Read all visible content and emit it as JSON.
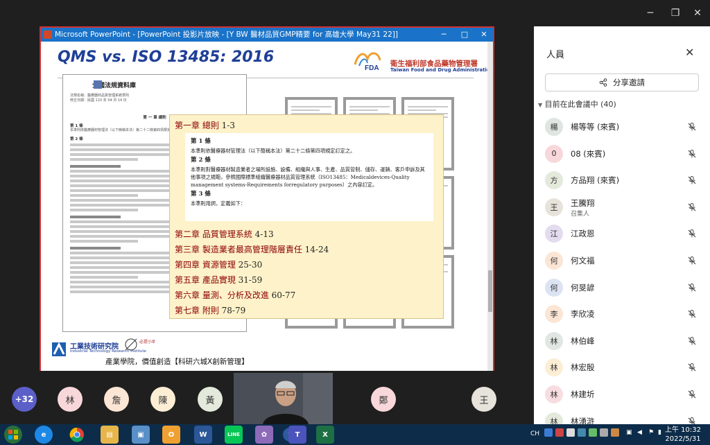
{
  "window": {
    "minimize_icon": "minimize-icon",
    "restore_icon": "restore-icon",
    "close_icon": "close-icon"
  },
  "ppt": {
    "title": "Microsoft PowerPoint - [PowerPoint 投影片放映 - [Y BW 醫材品質GMP精要 for 高雄大學 May31 22]]",
    "slide": {
      "title": "QMS vs. ISO 13485: 2016",
      "fda_name": "衛生福利部食品藥物管理署",
      "fda_en": "Taiwan Food and Drug Administration",
      "fda_logo": "FDA",
      "doc_header": "全國法規資料庫",
      "doc_lines": [
        "法規名稱：醫療器材品質管理系統準則",
        "修正日期：民國 110 年 04 月 14 日",
        "第 一 章 總則",
        "第 1 條",
        "本準則依醫療器材管理法（以下簡稱本法）第二十二條第四項規定訂定之。",
        "第 2 條"
      ],
      "popup": {
        "chapter1": "第一章 總則",
        "chapter1_range": "1-3",
        "art1_title": "第 1 條",
        "art1_text": "本準則依醫療器材管理法（以下簡稱本法）第二十二條第四項規定訂定之。",
        "art2_title": "第 2 條",
        "art2_text": "本準則對醫療器材製造業者之場所設施、設備、組織與人事、生產、品質管制、儲存、運銷、客戶申訴及其他事項之規範，參照國際標準組織醫療器材品質管理系統（ISO13485：Medicaldevices-Quality management systems-Requirements forregulatory purposes）之內容訂定。",
        "art3_title": "第 3 條",
        "art3_text": "本準則用詞，定義如下：",
        "chapters": [
          {
            "name": "第二章 品質管理系統",
            "range": "4-13"
          },
          {
            "name": "第三章 製造業者最高管理階層責任",
            "range": "14-24"
          },
          {
            "name": "第四章 資源管理",
            "range": "25-30"
          },
          {
            "name": "第五章 產品實現",
            "range": "31-59"
          },
          {
            "name": "第六章 量測、分析及改進",
            "range": "60-77"
          },
          {
            "name": "第七章 附則",
            "range": "78-79"
          }
        ]
      },
      "itri_cn": "工業技術研究院",
      "itri_en": "Industrial Technology Research Institute",
      "footer": "產業學院，價值創造【科研六城X創新管理】",
      "mascot_text": "必提小鳩"
    }
  },
  "panel": {
    "title": "人員",
    "share_label": "分享邀請",
    "section_label": "目前在此會議中 (40)",
    "people": [
      {
        "avatar": "楊",
        "name": "楊等等 (來賓)",
        "color": "#dfe5e0"
      },
      {
        "avatar": "0",
        "name": "08 (來賓)",
        "color": "#f8d7da"
      },
      {
        "avatar": "方",
        "name": "方品翔 (來賓)",
        "color": "#e3eadb"
      },
      {
        "avatar": "王",
        "name": "王騰翔",
        "sub": "召集人",
        "color": "#e7e3db"
      },
      {
        "avatar": "江",
        "name": "江政恩",
        "color": "#e3dcef"
      },
      {
        "avatar": "何",
        "name": "何文福",
        "color": "#fbe5d4"
      },
      {
        "avatar": "何",
        "name": "何旻諺",
        "color": "#dce3f2"
      },
      {
        "avatar": "李",
        "name": "李欣凌",
        "color": "#fbe5d4"
      },
      {
        "avatar": "林",
        "name": "林伯峰",
        "color": "#e0e6e2"
      },
      {
        "avatar": "林",
        "name": "林宏殷",
        "color": "#fbeed4"
      },
      {
        "avatar": "林",
        "name": "林建圻",
        "color": "#f8dde0"
      },
      {
        "avatar": "林",
        "name": "林湧滸",
        "color": "#e3eadb"
      }
    ]
  },
  "gallery": {
    "more_count": "+32",
    "avatars": [
      {
        "label": "林",
        "color": "#f8d7da"
      },
      {
        "label": "詹",
        "color": "#fbe5d4"
      },
      {
        "label": "陳",
        "color": "#fbeed4"
      },
      {
        "label": "黃",
        "color": "#e3eadb"
      },
      {
        "label": "鄭",
        "color": "#f8d7da"
      },
      {
        "label": "王",
        "color": "#e7e3db"
      }
    ]
  },
  "taskbar": {
    "ime": "CH",
    "time": "上午 10:32",
    "date": "2022/5/31",
    "apps": [
      "start",
      "ie",
      "chrome",
      "explorer",
      "notes",
      "outlook",
      "word",
      "line",
      "paint",
      "help",
      "teams",
      "excel"
    ],
    "word_label": "W",
    "line_label": "LINE",
    "excel_label": "X",
    "outlook_label": "O",
    "help_label": "?"
  }
}
